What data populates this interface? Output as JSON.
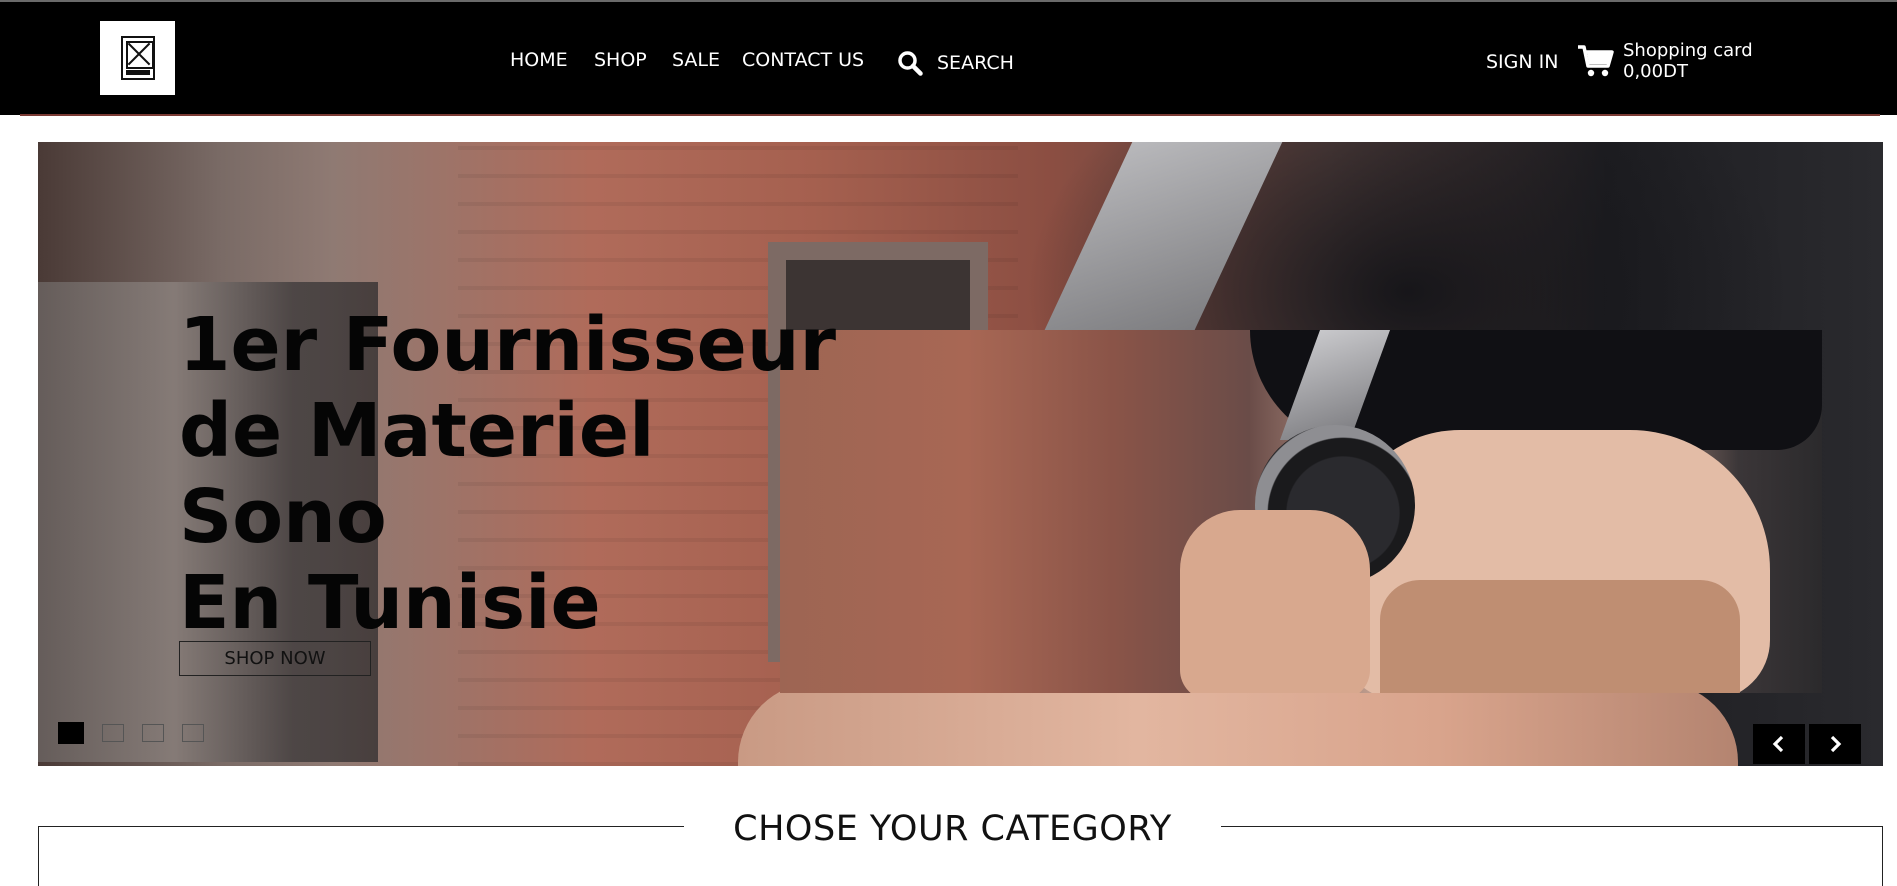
{
  "header": {
    "nav": [
      {
        "label": "HOME"
      },
      {
        "label": "SHOP"
      },
      {
        "label": "SALE"
      },
      {
        "label": "CONTACT US"
      }
    ],
    "search_label": "SEARCH",
    "signin_label": "SIGN IN",
    "cart": {
      "label": "Shopping card",
      "total": "0,00DT"
    },
    "icons": [
      "logo",
      "search-icon",
      "cart-icon"
    ]
  },
  "hero": {
    "title_lines": [
      "1er Fournisseur",
      "de Materiel",
      "Sono",
      "En Tunisie"
    ],
    "cta_label": "SHOP NOW",
    "slides_count": 4,
    "active_slide": 1,
    "icons": [
      "chevron-left-icon",
      "chevron-right-icon"
    ]
  },
  "category": {
    "title": "CHOSE YOUR CATEGORY"
  },
  "colors": {
    "header_bg": "#000000",
    "header_accent": "#7a3a34",
    "text_dark": "#050505"
  }
}
